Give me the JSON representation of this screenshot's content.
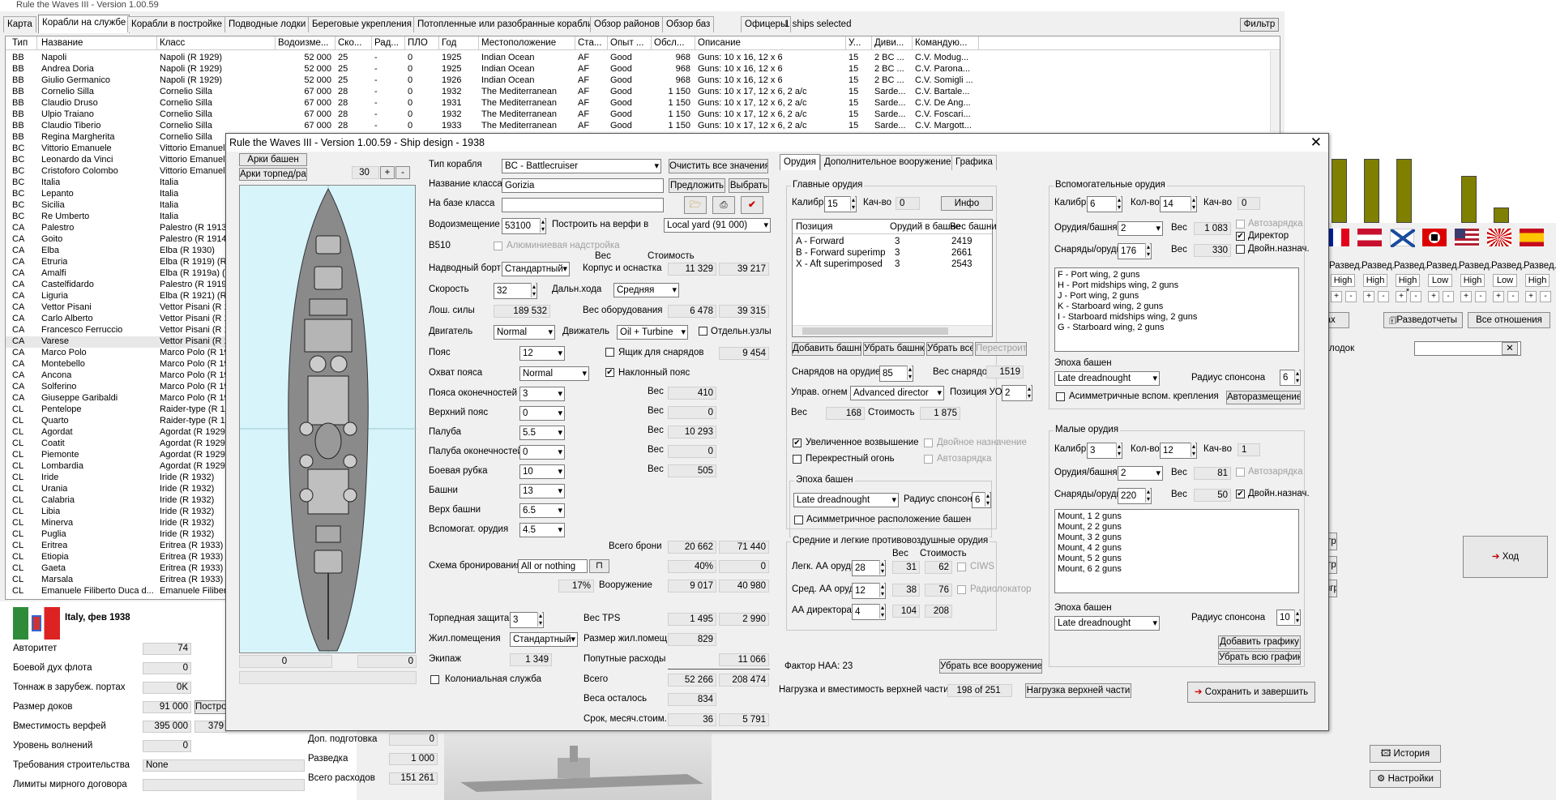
{
  "app": {
    "title": "Rule the Waves III - Version 1.00.59"
  },
  "tabs": [
    "Карта",
    "Корабли на службе",
    "Корабли в постройке",
    "Подводные лодки",
    "Береговые укрепления",
    "Потопленные или разобранные корабли",
    "Обзор районов",
    "Обзор баз",
    "Офицеры"
  ],
  "ships_selected": "1 ships selected",
  "filter_label": "Фильтр",
  "list": {
    "headers": [
      "Тип",
      "Название",
      "Класс",
      "Водоизме...",
      "Ско...",
      "Рад...",
      "ПЛО",
      "Год",
      "Местоположение",
      "Ста...",
      "Опыт ...",
      "Обсл...",
      "Описание",
      "У...",
      "Диви...",
      "Командую..."
    ],
    "rows": [
      [
        "BB",
        "Napoli",
        "Napoli (R 1929)",
        "52 000",
        "25",
        "-",
        "0",
        "1925",
        "Indian Ocean",
        "AF",
        "Good",
        "968",
        "Guns: 10 x 16, 12 x 6",
        "15",
        "2 BC ...",
        "C.V. Modug..."
      ],
      [
        "BB",
        "Andrea Doria",
        "Napoli (R 1929)",
        "52 000",
        "25",
        "-",
        "0",
        "1925",
        "Indian Ocean",
        "AF",
        "Good",
        "968",
        "Guns: 10 x 16, 12 x 6",
        "15",
        "2 BC ...",
        "C.V. Parona..."
      ],
      [
        "BB",
        "Giulio Germanico",
        "Napoli (R 1929)",
        "52 000",
        "25",
        "-",
        "0",
        "1926",
        "Indian Ocean",
        "AF",
        "Good",
        "968",
        "Guns: 10 x 16, 12 x 6",
        "15",
        "2 BC ...",
        "C.V. Somigli ..."
      ],
      [
        "BB",
        "Cornelio Silla",
        "Cornelio Silla",
        "67 000",
        "28",
        "-",
        "0",
        "1932",
        "The Mediterranean",
        "AF",
        "Good",
        "1 150",
        "Guns: 10 x 17, 12 x 6, 2 a/c",
        "15",
        "Sarde...",
        "C.V. Bartale..."
      ],
      [
        "BB",
        "Claudio Druso",
        "Cornelio Silla",
        "67 000",
        "28",
        "-",
        "0",
        "1931",
        "The Mediterranean",
        "AF",
        "Good",
        "1 150",
        "Guns: 10 x 17, 12 x 6, 2 a/c",
        "15",
        "Sarde...",
        "C.V. De Ang..."
      ],
      [
        "BB",
        "Ulpio Traiano",
        "Cornelio Silla",
        "67 000",
        "28",
        "-",
        "0",
        "1932",
        "The Mediterranean",
        "AF",
        "Good",
        "1 150",
        "Guns: 10 x 17, 12 x 6, 2 a/c",
        "15",
        "Sarde...",
        "C.V. Foscari..."
      ],
      [
        "BB",
        "Claudio Tiberio",
        "Cornelio Silla",
        "67 000",
        "28",
        "-",
        "0",
        "1933",
        "The Mediterranean",
        "AF",
        "Good",
        "1 150",
        "Guns: 10 x 17, 12 x 6, 2 a/c",
        "15",
        "Sarde...",
        "C.V. Margott..."
      ],
      [
        "BB",
        "Regina Margherita",
        "Cornelio Silla"
      ],
      [
        "BC",
        "Vittorio Emanuele",
        "Vittorio Emanuele"
      ],
      [
        "BC",
        "Leonardo da Vinci",
        "Vittorio Emanuele"
      ],
      [
        "BC",
        "Cristoforo Colombo",
        "Vittorio Emanuele"
      ],
      [
        "BC",
        "Italia",
        "Italia"
      ],
      [
        "BC",
        "Lepanto",
        "Italia"
      ],
      [
        "BC",
        "Sicilia",
        "Italia"
      ],
      [
        "BC",
        "Re Umberto",
        "Italia"
      ],
      [
        "CA",
        "Palestro",
        "Palestro (R 1913)"
      ],
      [
        "CA",
        "Goito",
        "Palestro (R 1914)"
      ],
      [
        "CA",
        "Elba",
        "Elba (R 1930)"
      ],
      [
        "CA",
        "Etruria",
        "Elba (R 1919) (R"
      ],
      [
        "CA",
        "Amalfi",
        "Elba (R 1919a) (R"
      ],
      [
        "CA",
        "Castelfidardo",
        "Palestro (R 1919)"
      ],
      [
        "CA",
        "Liguria",
        "Elba (R 1921) (R"
      ],
      [
        "CA",
        "Vettor Pisani",
        "Vettor Pisani (R 1"
      ],
      [
        "CA",
        "Carlo Alberto",
        "Vettor Pisani (R 1"
      ],
      [
        "CA",
        "Francesco Ferruccio",
        "Vettor Pisani (R 1"
      ],
      [
        "CA",
        "Varese",
        "Vettor Pisani (R 1"
      ],
      [
        "CA",
        "Marco Polo",
        "Marco Polo (R 19"
      ],
      [
        "CA",
        "Montebello",
        "Marco Polo (R 19"
      ],
      [
        "CA",
        "Ancona",
        "Marco Polo (R 19"
      ],
      [
        "CA",
        "Solferino",
        "Marco Polo (R 19"
      ],
      [
        "CA",
        "Giuseppe Garibaldi",
        "Marco Polo (R 19"
      ],
      [
        "CL",
        "Pentelope",
        "Raider-type (R 19"
      ],
      [
        "CL",
        "Quarto",
        "Raider-type (R 19"
      ],
      [
        "CL",
        "Agordat",
        "Agordat (R 1929)"
      ],
      [
        "CL",
        "Coatit",
        "Agordat (R 1929)"
      ],
      [
        "CL",
        "Piemonte",
        "Agordat (R 1929)"
      ],
      [
        "CL",
        "Lombardia",
        "Agordat (R 1929)"
      ],
      [
        "CL",
        "Iride",
        "Iride (R 1932)"
      ],
      [
        "CL",
        "Urania",
        "Iride (R 1932)"
      ],
      [
        "CL",
        "Calabria",
        "Iride (R 1932)"
      ],
      [
        "CL",
        "Libia",
        "Iride (R 1932)"
      ],
      [
        "CL",
        "Minerva",
        "Iride (R 1932)"
      ],
      [
        "CL",
        "Puglia",
        "Iride (R 1932)"
      ],
      [
        "CL",
        "Eritrea",
        "Eritrea (R 1933)"
      ],
      [
        "CL",
        "Etiopia",
        "Eritrea (R 1933)"
      ],
      [
        "CL",
        "Gaeta",
        "Eritrea (R 1933)"
      ],
      [
        "CL",
        "Marsala",
        "Eritrea (R 1933)"
      ],
      [
        "CL",
        "Emanuele Filiberto Duca d...",
        "Emanuele Filiberto"
      ]
    ]
  },
  "nation": {
    "name": "Italy, фев 1938",
    "rows": [
      {
        "label": "Авторитет",
        "value": "74"
      },
      {
        "label": "Боевой дух флота",
        "value": "0"
      },
      {
        "label": "Тоннаж в зарубеж. портах",
        "value": "0K"
      },
      {
        "label": "Размер доков",
        "value": "91 000"
      },
      {
        "label": "Вместимость верфей",
        "value": "395 000"
      },
      {
        "label": "Уровень волнений",
        "value": "0"
      },
      {
        "label": "Требования строительства",
        "value": "None"
      },
      {
        "label": "Лимиты мирного договора",
        "value": ""
      }
    ],
    "extra_val": "379",
    "build_btn": "Постро",
    "mid_rows": [
      {
        "label": "Доп. подготовка",
        "value": "0"
      },
      {
        "label": "Разведка",
        "value": "1 000"
      },
      {
        "label": "Всего расходов",
        "value": "151 261"
      }
    ]
  },
  "dialog": {
    "title": "Rule the Waves III - Version 1.00.59 - Ship design - 1938",
    "close": "✕",
    "arcs_turret": "Арки башен",
    "arcs_torp": "Арки торпед/ракет",
    "arc_value": "30",
    "plus": "+",
    "minus": "-",
    "ship_coord_left": "0",
    "ship_coord_right": "0",
    "labels": {
      "ship_type": "Тип корабля",
      "class_name": "Название класса",
      "based_on": "На базе класса",
      "displacement": "Водоизмещение",
      "build_at": "Построить на верфи в",
      "b510": "B510",
      "aluminum": "Алюминиевая надстройка",
      "freeboard": "Надводный борт",
      "hull": "Корпус и оснастка",
      "speed": "Скорость",
      "range": "Дальн.хода",
      "hp": "Лош. силы",
      "equipment": "Вес оборудования",
      "engine": "Двигатель",
      "drive": "Движатель",
      "sep_units": "Отдельн.узлы",
      "belt": "Пояс",
      "shell_box": "Ящик для снарядов",
      "belt_cover": "Охват пояса",
      "sloped_belt": "Наклонный пояс",
      "belt_ends": "Пояса оконечностей",
      "upper_belt": "Верхний пояс",
      "deck": "Палуба",
      "deck_ends": "Палуба оконечностей",
      "conning_tower": "Боевая рубка",
      "turrets": "Башни",
      "turret_top": "Верх башни",
      "secondary": "Вспомогат. орудия",
      "total_armor": "Всего брони",
      "armor_scheme": "Схема бронирования",
      "armament": "Вооружение",
      "torpedo_def": "Торпедная защита",
      "tps_weight": "Вес TPS",
      "quarters": "Жил.помещения",
      "quarters_size": "Размер жил.помещ.",
      "crew": "Экипаж",
      "misc": "Попутные расходы",
      "colonial": "Колониальная служба",
      "total": "Всего",
      "weight_left": "Веса осталось",
      "build_time": "Срок, месяч.стоим.",
      "weight_col": "Вес",
      "cost_col": "Стоимость",
      "weight_short": "Вес"
    },
    "values": {
      "ship_type": "BC - Battlecruiser",
      "class_name": "Gorizia",
      "based_on": "",
      "displacement": "53100",
      "build_at": "Local yard (91 000)",
      "freeboard": "Стандартный",
      "hull_w": "11 329",
      "hull_c": "39 217",
      "speed": "32",
      "range": "Средняя",
      "hp": "189 532",
      "equip_w": "6 478",
      "equip_c": "39 315",
      "engine": "Normal",
      "drive": "Oil + Turbine",
      "belt": "12",
      "shell_box": "9 454",
      "belt_cover": "Normal",
      "belt_ends": "3",
      "belt_ends_w": "410",
      "upper_belt": "0",
      "upper_belt_w": "0",
      "deck": "5.5",
      "deck_w": "10 293",
      "deck_ends": "0",
      "deck_ends_w": "0",
      "conning": "10",
      "conning_w": "505",
      "turrets": "13",
      "turret_top": "6.5",
      "secondary": "4.5",
      "total_armor_w": "20 662",
      "total_armor_c": "71 440",
      "armor_scheme": "All or nothing",
      "pct40": "40%",
      "pct40_c": "0",
      "pct17": "17%",
      "arm_w": "9 017",
      "arm_c": "40 980",
      "torpedo": "3",
      "tps_w": "1 495",
      "tps_c": "2 990",
      "quarters": "Стандартный",
      "quarters_size": "829",
      "crew": "1 349",
      "misc": "11 066",
      "total_w": "52 266",
      "total_c": "208 474",
      "left": "834",
      "build_months": "36",
      "build_cost": "5 791"
    },
    "buttons": {
      "clear": "Очистить все значения",
      "suggest": "Предложить",
      "choose": "Выбрать",
      "save_finish": "Сохранить и завершить",
      "upper_load": "Нагрузка верхней части"
    },
    "upper_load_label": "Нагрузка и вместимость верхней части",
    "upper_load_value": "198 of 251",
    "tabs": [
      "Орудия",
      "Дополнительное вооружение",
      "Графика"
    ],
    "main_guns": {
      "title": "Главные орудия",
      "caliber_label": "Калибр",
      "caliber": "15",
      "qty_label": "Кач-во",
      "qty": "0",
      "info": "Инфо",
      "cols": [
        "Позиция",
        "Орудий в башне",
        "Вес башни"
      ],
      "rows": [
        [
          "A - Forward",
          "3",
          "2419"
        ],
        [
          "B - Forward superimpo...",
          "3",
          "2661"
        ],
        [
          "X - Aft superimposed",
          "3",
          "2543"
        ]
      ],
      "add": "Добавить башню",
      "remove": "Убрать башню",
      "remove_all": "Убрать все",
      "rebuild": "Перестроить",
      "shells_label": "Снарядов на орудие",
      "shells": "85",
      "shell_weight_label": "Вес снарядов",
      "shell_weight": "1519",
      "fc_label": "Управ. огнем",
      "fc": "Advanced director",
      "fc_pos_label": "Позиция УО",
      "fc_pos": "2",
      "w_label": "Вес",
      "w": "168",
      "c_label": "Стоимость",
      "c": "1 875",
      "elev": "Увеличенное возвышение",
      "dual": "Двойное назначение",
      "cross": "Перекрестный огонь",
      "autoload": "Автозарядка",
      "era_label": "Эпоха башен",
      "era": "Late dreadnought",
      "sponson_label": "Радиус спонсона",
      "sponson": "6",
      "asym": "Асимметричное расположение башен"
    },
    "aa": {
      "title": "Средние и легкие противовоздушные орудия",
      "w_col": "Вес",
      "c_col": "Стоимость",
      "light": "Легк. АА орудия",
      "light_v": "28",
      "light_w": "31",
      "light_c": "62",
      "ciws": "CIWS",
      "med": "Сред. АА орудия",
      "med_v": "12",
      "med_w": "38",
      "med_c": "76",
      "radar": "Радиолокатор",
      "dir": "АА директора",
      "dir_v": "4",
      "dir_w": "104",
      "dir_c": "208"
    },
    "haa_label": "Фактор НАА: 23",
    "remove_all_arm": "Убрать все вооружение",
    "secondary": {
      "title": "Вспомогательные орудия",
      "caliber_label": "Калибр",
      "caliber": "6",
      "qty_label": "Кол-во",
      "qty": "14",
      "qty2_label": "Кач-во",
      "qty2": "0",
      "per_turret_label": "Орудия/башня",
      "per_turret": "2",
      "w_label": "Вес",
      "w": "1 083",
      "autoload": "Автозарядка",
      "shells_label": "Снаряды/орудие",
      "shells": "176",
      "w2": "330",
      "director": "Директор",
      "dual": "Двойн.назнач.",
      "list": [
        "F - Port wing, 2 guns",
        "H - Port midships wing, 2 guns",
        "J - Port wing, 2 guns",
        "K - Starboard wing, 2 guns",
        "I - Starboard midships wing, 2 guns",
        "G - Starboard wing, 2 guns"
      ],
      "era_label": "Эпоха башен",
      "era": "Late dreadnought",
      "sponson_label": "Радиус спонсона",
      "sponson": "6",
      "asym": "Асимметричные вспом. крепления",
      "auto_place": "Авторазмещение"
    },
    "small": {
      "title": "Малые орудия",
      "caliber_label": "Калибр",
      "caliber": "3",
      "qty_label": "Кол-во",
      "qty": "12",
      "qty2_label": "Кач-во",
      "qty2": "1",
      "per_turret_label": "Орудия/башня",
      "per_turret": "2",
      "w_label": "Вес",
      "w": "81",
      "autoload": "Автозарядка",
      "shells_label": "Снаряды/орудие",
      "shells": "220",
      "w2": "50",
      "dual": "Двойн.назнач.",
      "list": [
        "Mount, 1 2 guns",
        "Mount, 2 2 guns",
        "Mount, 3 2 guns",
        "Mount, 4 2 guns",
        "Mount, 5 2 guns",
        "Mount, 6 2 guns"
      ],
      "era_label": "Эпоха башен",
      "era": "Late dreadnought",
      "sponson_label": "Радиус спонсона",
      "sponson": "10",
      "add_graphics": "Добавить графику",
      "remove_graphics": "Убрать всю графику"
    }
  },
  "right": {
    "intel": [
      "Развед.",
      "Развед.",
      "Развед.",
      "Развед.",
      "Развед.",
      "Развед.",
      "Развед."
    ],
    "levels": [
      "High",
      "High",
      "High *",
      "Low",
      "High",
      "Low",
      "High"
    ],
    "bar_levels": [
      0.63,
      0.63,
      0.63,
      0,
      0.46,
      0.15,
      0
    ],
    "btn_admiral": "льманах",
    "btn_intel": "Разведотчеты",
    "btn_relations": "Все отношения",
    "sub_label": "тройк. подлодок",
    "save_game": "хранить игру",
    "load_game": "ировать игру",
    "end_game": "вершить игру",
    "turn": "Ход",
    "history": "История",
    "settings": "Настройки"
  }
}
